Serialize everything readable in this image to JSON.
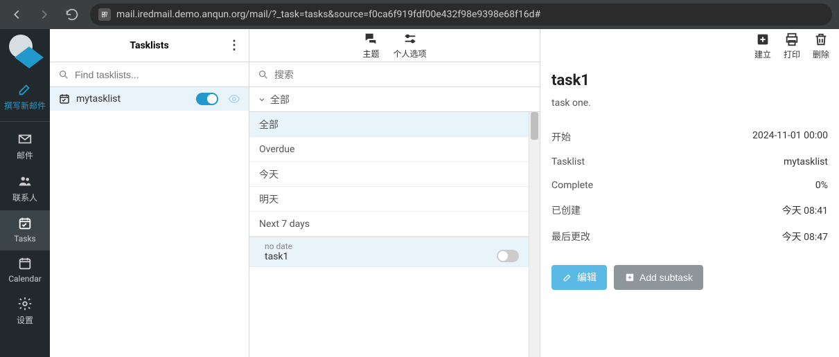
{
  "browser": {
    "url": "mail.iredmail.demo.anqun.org/mail/?_task=tasks&source=f0ca6f919fdf00e432f98e9398e68f16d#"
  },
  "leftnav": {
    "compose": "撰写新邮件",
    "mail": "邮件",
    "contacts": "联系人",
    "tasks": "Tasks",
    "calendar": "Calendar",
    "settings": "设置"
  },
  "col1": {
    "title": "Tasklists",
    "search_placeholder": "Find tasklists...",
    "items": [
      {
        "name": "mytasklist"
      }
    ]
  },
  "col2": {
    "tools": {
      "topic": "主题",
      "options": "个人选项"
    },
    "search_placeholder": "搜索",
    "all_label": "全部",
    "filters": [
      {
        "label": "全部",
        "selected": true
      },
      {
        "label": "Overdue"
      },
      {
        "label": "今天"
      },
      {
        "label": "明天"
      },
      {
        "label": "Next 7 days"
      }
    ],
    "tasks": [
      {
        "date_label": "no date",
        "name": "task1"
      }
    ]
  },
  "col3": {
    "tools": {
      "create": "建立",
      "print": "打印",
      "delete": "删除"
    },
    "title": "task1",
    "desc": "task one.",
    "rows": [
      {
        "label": "开始",
        "value": "2024-11-01 00:00"
      },
      {
        "label": "Tasklist",
        "value": "mytasklist"
      },
      {
        "label": "Complete",
        "value": "0%"
      },
      {
        "label": "已创建",
        "value": "今天 08:41"
      },
      {
        "label": "最后更改",
        "value": "今天 08:47"
      }
    ],
    "buttons": {
      "edit": "编辑",
      "add_subtask": "Add subtask"
    }
  }
}
